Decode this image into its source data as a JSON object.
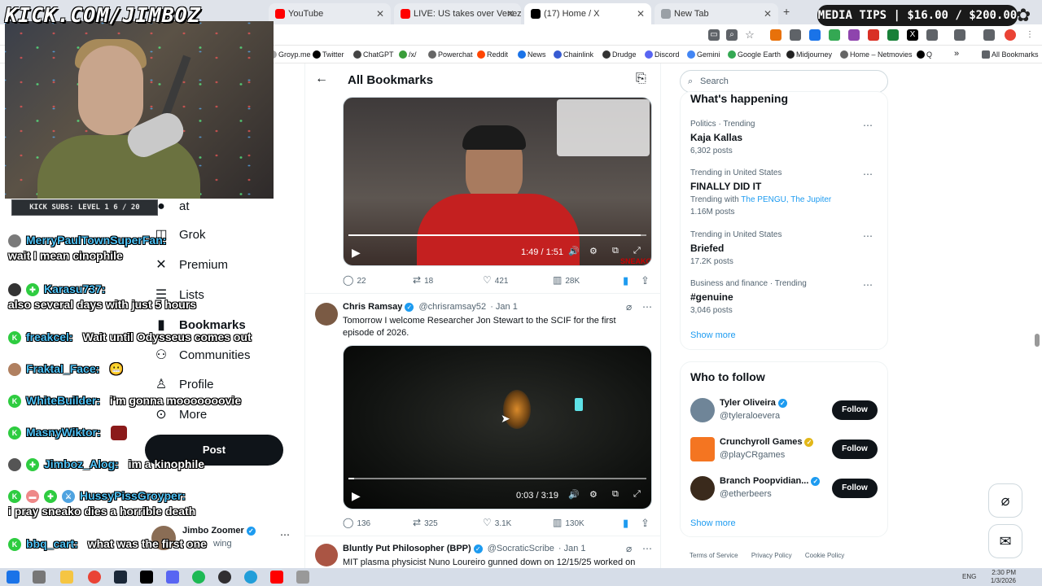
{
  "stream": {
    "kick_url": "KICK.COM/JIMBOZ",
    "subs_bar": "KICK SUBS: LEVEL 1 6 / 20",
    "media_tips": "MEDIA TIPS | $16.00 / $200.00"
  },
  "browser": {
    "tabs": [
      {
        "title": "YouTube",
        "color": "#ff0000"
      },
      {
        "title": "LIVE: US takes over Venezuela a",
        "color": "#ff0000"
      },
      {
        "title": "(17) Home / X",
        "color": "#000000"
      },
      {
        "title": "New Tab",
        "color": "#9aa0a6"
      }
    ],
    "new_tab": "+",
    "bookmarks": [
      "Groyp.me",
      "Twitter",
      "ChatGPT",
      "/x/",
      "Powerchat",
      "Reddit",
      "News",
      "Chainlink",
      "Drudge",
      "Discord",
      "Gemini",
      "Google Earth",
      "Midjourney",
      "Home – Netmovies",
      "Q"
    ],
    "bookmarks_more": "»",
    "all_bookmarks": "All Bookmarks"
  },
  "x_nav": {
    "items": [
      {
        "label": "at",
        "icon": "chat-icon"
      },
      {
        "label": "Grok",
        "icon": "grok-icon"
      },
      {
        "label": "Premium",
        "icon": "x-logo-icon"
      },
      {
        "label": "Lists",
        "icon": "list-icon"
      },
      {
        "label": "Bookmarks",
        "icon": "bookmark-icon"
      },
      {
        "label": "Communities",
        "icon": "communities-icon"
      },
      {
        "label": "Profile",
        "icon": "profile-icon"
      },
      {
        "label": "More",
        "icon": "more-icon"
      }
    ],
    "post_label": "Post",
    "account_name": "Jimbo Zoomer",
    "account_sub": "wing"
  },
  "chat": [
    {
      "user": "MerryPaulTownSuperFan:",
      "msg": "",
      "second_line": "wait I mean cinophile",
      "badge_color": "#7a7a7a",
      "badge": ""
    },
    {
      "user": "Karasu737:",
      "msg": "",
      "second_line": "also several days with just 5 hours",
      "badge_color": "#333333",
      "badge": ""
    },
    {
      "user": "freakcel:",
      "msg": "Wait until Odysseus comes out",
      "second_line": "",
      "badge_color": "#2ecc40",
      "badge": "K"
    },
    {
      "user": "Fraktal_Face:",
      "msg": "😬",
      "second_line": "",
      "badge_color": "#b08060",
      "badge": ""
    },
    {
      "user": "WhiteBuilder:",
      "msg": "i'm gonna mooooooovie",
      "second_line": "",
      "badge_color": "#2ecc40",
      "badge": "K"
    },
    {
      "user": "MasnyWiktor:",
      "msg": "",
      "second_line": "",
      "badge_color": "#2ecc40",
      "badge": "K"
    },
    {
      "user": "Jimboz_Alog:",
      "msg": "im a kinophile",
      "second_line": "",
      "badge_color": "#555555",
      "badge": ""
    },
    {
      "user": "HussyPissGroyper:",
      "msg": "",
      "second_line": "i pray sneako dies a horrible death",
      "badge_color": "#2ecc40",
      "badge": "K"
    },
    {
      "user": "bbq_cart:",
      "msg": "what was the first one",
      "second_line": "",
      "badge_color": "#2ecc40",
      "badge": "K"
    }
  ],
  "main": {
    "title": "All Bookmarks",
    "tweet1": {
      "video_time": "1:49 / 1:51",
      "watermark": "SNEAKO",
      "replies": "22",
      "reposts": "18",
      "likes": "421",
      "views": "28K",
      "progress": 0.98
    },
    "tweet2": {
      "name": "Chris Ramsay",
      "handle": "@chrisramsay52",
      "date": "· Jan 1",
      "text": "Tomorrow I welcome Researcher Jon Stewart to the SCIF for the first episode of 2026.",
      "video_time": "0:03 / 3:19",
      "replies": "136",
      "reposts": "325",
      "likes": "3.1K",
      "views": "130K",
      "progress": 0.02
    },
    "tweet3": {
      "name": "Bluntly Put Philosopher (BPP)",
      "handle": "@SocraticScribe",
      "date": "· Jan 1",
      "text": "MIT plasma physicist Nuno Loureiro gunned down on 12/15/25 worked on"
    }
  },
  "sidebar": {
    "search_placeholder": "Search",
    "whats_happening": "What's happening",
    "trends": [
      {
        "meta": "Politics · Trending",
        "title": "Kaja Kallas",
        "posts": "6,302 posts",
        "with": ""
      },
      {
        "meta": "Trending in United States",
        "title": "FINALLY DID IT",
        "posts": "1.16M posts",
        "with": "Trending with",
        "with_links": "The PENGU, The Jupiter"
      },
      {
        "meta": "Trending in United States",
        "title": "Briefed",
        "posts": "17.2K posts",
        "with": ""
      },
      {
        "meta": "Business and finance · Trending",
        "title": "#genuine",
        "posts": "3,046 posts",
        "with": ""
      }
    ],
    "show_more": "Show more",
    "who_to_follow": "Who to follow",
    "follows": [
      {
        "name": "Tyler Oliveira",
        "handle": "@tyleraloevera",
        "tick": "blue"
      },
      {
        "name": "Crunchyroll Games",
        "handle": "@playCRgames",
        "tick": "gold"
      },
      {
        "name": "Branch Poopvidian...",
        "handle": "@etherbeers",
        "tick": "blue"
      }
    ],
    "follow_label": "Follow",
    "footer": [
      "Terms of Service",
      "Privacy Policy",
      "Cookie Policy"
    ]
  },
  "taskbar": {
    "lang": "ENG",
    "time": "2:30 PM",
    "date": "1/3/2026"
  },
  "colors": {
    "x_blue": "#1d9bf0",
    "x_black": "#0f1419",
    "muted": "#536471"
  }
}
